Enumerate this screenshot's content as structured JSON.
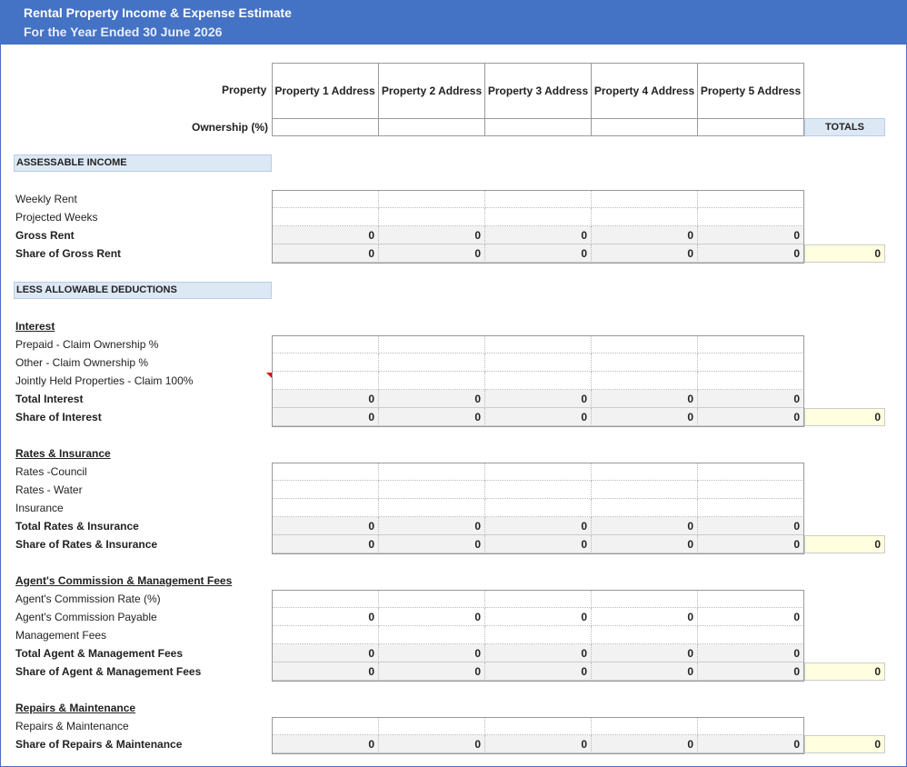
{
  "header": {
    "title": "Rental Property Income & Expense Estimate",
    "subtitle": "For the Year Ended 30 June 2026"
  },
  "columns": {
    "property_label": "Property",
    "ownership_label": "Ownership (%)",
    "properties": [
      "Property 1 Address",
      "Property 2 Address",
      "Property 3 Address",
      "Property 4 Address",
      "Property 5 Address"
    ],
    "totals_label": "TOTALS"
  },
  "sections": {
    "income_banner": "ASSESSABLE INCOME",
    "deductions_banner": "LESS ALLOWABLE DEDUCTIONS",
    "interest_title": "Interest",
    "rates_title": "Rates & Insurance",
    "agent_title": "Agent's Commission & Management Fees",
    "repairs_title": "Repairs & Maintenance"
  },
  "rows": {
    "weekly_rent": "Weekly Rent",
    "projected_weeks": "Projected Weeks",
    "gross_rent": "Gross Rent",
    "share_gross_rent": "Share of Gross Rent",
    "prepaid": "Prepaid - Claim Ownership %",
    "other": "Other - Claim Ownership %",
    "jointly": "Jointly Held Properties - Claim 100%",
    "total_interest": "Total Interest",
    "share_interest": "Share of Interest",
    "rates_council": "Rates -Council",
    "rates_water": "Rates - Water",
    "insurance": "Insurance",
    "total_rates": "Total Rates & Insurance",
    "share_rates": "Share of Rates & Insurance",
    "agent_rate": "Agent's Commission Rate (%)",
    "agent_payable": "Agent's Commission Payable",
    "mgmt_fees": "Management Fees",
    "total_agent": "Total Agent & Management Fees",
    "share_agent": "Share of Agent & Management Fees",
    "repairs": "Repairs & Maintenance",
    "share_repairs": "Share of Repairs & Maintenance"
  },
  "values": {
    "zero": "0"
  }
}
